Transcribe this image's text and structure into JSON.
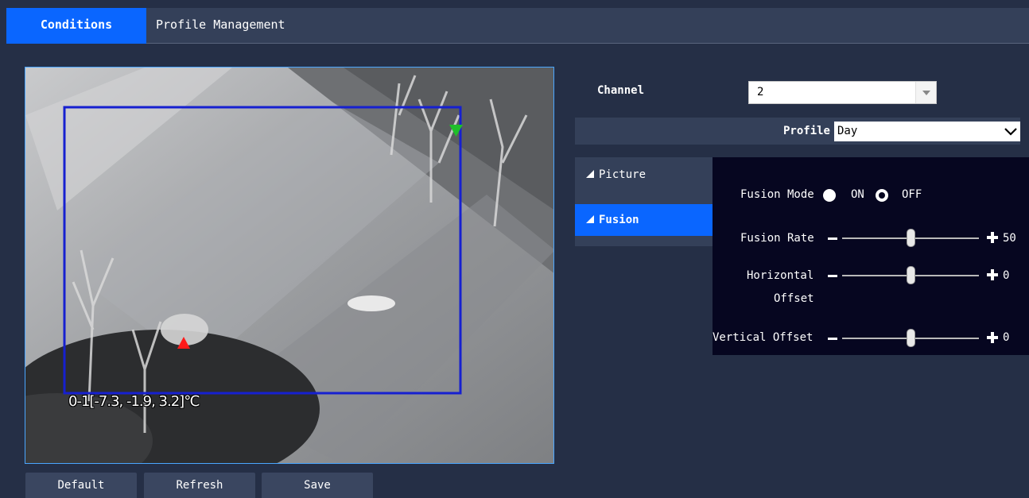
{
  "tabs": [
    {
      "label": "Conditions",
      "active": true
    },
    {
      "label": "Profile Management",
      "active": false
    }
  ],
  "video": {
    "temperature_label": "0-1[-7.3, -1.9, 3.2]℃",
    "box_color": "#1620d0",
    "max_marker_color": "#1fbf2a",
    "min_marker_color": "#ff1a1a"
  },
  "buttons": {
    "default": "Default",
    "refresh": "Refresh",
    "save": "Save"
  },
  "channel": {
    "label": "Channel",
    "value": "2"
  },
  "profile": {
    "label": "Profile",
    "value": "Day"
  },
  "menu": [
    {
      "label": "Picture",
      "active": false
    },
    {
      "label": "Fusion",
      "active": true
    }
  ],
  "fusion": {
    "mode_label": "Fusion Mode",
    "mode_on": "ON",
    "mode_off": "OFF",
    "mode_selected": "OFF",
    "rate_label": "Fusion Rate",
    "rate_value": "50",
    "horizontal_label_1": "Horizontal",
    "horizontal_label_2": "Offset",
    "horizontal_value": "0",
    "vertical_label": "Vertical Offset",
    "vertical_value": "0"
  },
  "colors": {
    "accent": "#0a66ff",
    "background": "#252f46",
    "panel": "#060620"
  }
}
